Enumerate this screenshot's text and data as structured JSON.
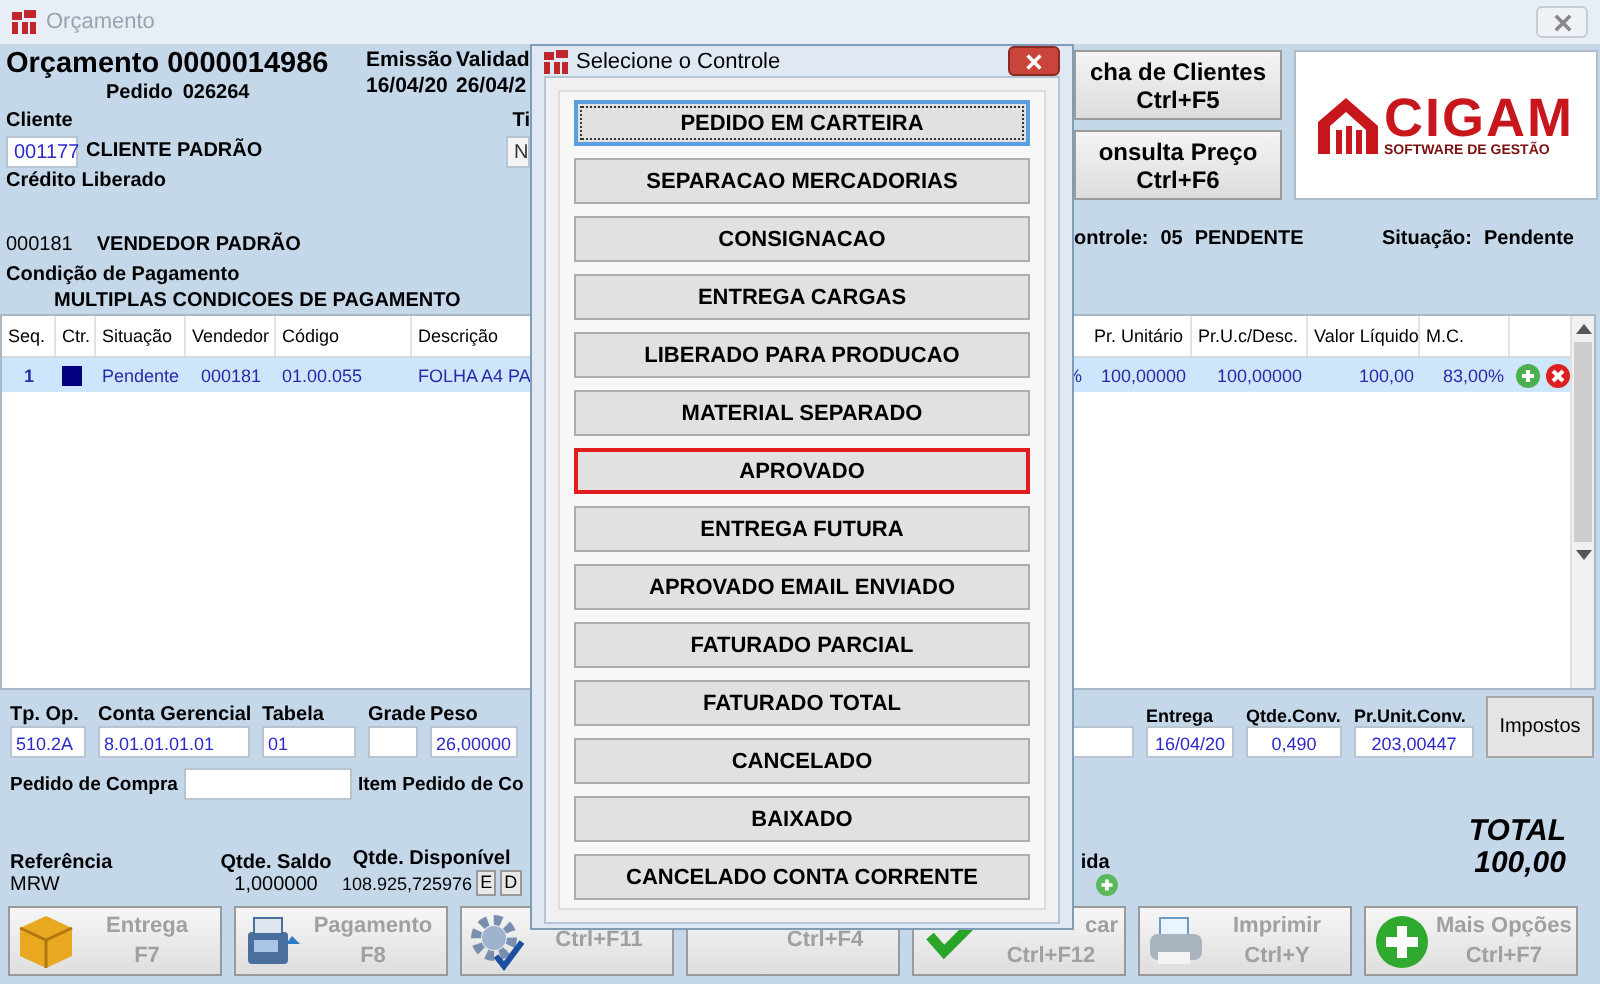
{
  "window": {
    "title": "Orçamento"
  },
  "header": {
    "title": "Orçamento 0000014986",
    "pedido_label": "Pedido",
    "pedido": "026264",
    "emissao_label": "Emissão",
    "emissao": "16/04/20",
    "validade_label": "Validad",
    "validade": "26/04/2",
    "cliente_label": "Cliente",
    "cliente_code": "001177",
    "cliente_name": "CLIENTE PADRÃO",
    "column_label": "Ti",
    "column_value": "N",
    "credito": "Crédito Liberado",
    "vendedor_code": "000181",
    "vendedor_name": "VENDEDOR PADRÃO",
    "condicao_label": "Condição de Pagamento",
    "condicao": "MULTIPLAS CONDICOES DE PAGAMENTO",
    "controle_label": "ontrole:",
    "controle_code": "05",
    "controle_status": "PENDENTE",
    "situacao_label": "Situação:",
    "situacao": "Pendente"
  },
  "side_buttons": [
    {
      "label": "cha de Clientes",
      "shortcut": "Ctrl+F5"
    },
    {
      "label": "onsulta Preço",
      "shortcut": "Ctrl+F6"
    }
  ],
  "logo": {
    "name": "CIGAM",
    "tagline": "SOFTWARE DE GESTÃO"
  },
  "table": {
    "columns": [
      "Seq.",
      "Ctr.",
      "Situação",
      "Vendedor",
      "Código",
      "Descrição",
      "Pr. Unitário",
      "Pr.U.c/Desc.",
      "Valor Líquido",
      "M.C."
    ],
    "rows": [
      {
        "selected": true,
        "seq": "1",
        "color": "#000080",
        "situacao": "Pendente",
        "vendedor": "000181",
        "codigo": "01.00.055",
        "descricao": "FOLHA A4 PA",
        "column_7": "%",
        "pr_unitario": "100,00000",
        "pr_uc_desc": "100,00000",
        "valor_liquido": "100,00",
        "mc": "83,00%"
      }
    ]
  },
  "fields": [
    {
      "label": "Tp. Op.",
      "value": "510.2A"
    },
    {
      "label": "Conta Gerencial",
      "value": "8.01.01.01.01"
    },
    {
      "label": "Tabela",
      "value": "01"
    },
    {
      "label": "Grade"
    },
    {
      "label": "Peso",
      "value": "26,00000"
    }
  ],
  "fields_right": [
    {
      "label": "Entrega",
      "value": "16/04/20"
    },
    {
      "label": "Qtde.Conv.",
      "value": "0,490"
    },
    {
      "label": "Pr.Unit.Conv.",
      "value": "203,00447"
    }
  ],
  "impostos_button": "Impostos",
  "pedido_compra_label": "Pedido de Compra",
  "item_pedido_label": "Item Pedido de Co",
  "referencia_label": "Referência",
  "referencia": "MRW",
  "saldo_label": "Qtde. Saldo",
  "saldo": "1,000000",
  "disponivel_label": "Qtde. Disponível",
  "disponivel": "108.925,725976",
  "disponivel_flags": [
    "E",
    "D"
  ],
  "column_ida_label": "ida",
  "total_label": "TOTAL",
  "total": "100,00",
  "bottom_buttons": [
    {
      "kind": "box",
      "label": "Entrega",
      "shortcut": "F7"
    },
    {
      "kind": "register",
      "label": "Pagamento",
      "shortcut": "F8"
    },
    {
      "kind": "gear",
      "shortcut": "Ctrl+F11"
    },
    {
      "kind": "plain",
      "shortcut": "Ctrl+F4"
    },
    {
      "kind": "check",
      "label": "car",
      "shortcut": "Ctrl+F12"
    },
    {
      "kind": "printer",
      "label": "Imprimir",
      "shortcut": "Ctrl+Y"
    },
    {
      "kind": "plus",
      "label": "Mais Opções",
      "shortcut": "Ctrl+F7"
    }
  ],
  "dialog": {
    "title": "Selecione o Controle",
    "options": [
      {
        "label": "PEDIDO EM CARTEIRA",
        "selected": false,
        "focused": true
      },
      {
        "label": "SEPARACAO MERCADORIAS",
        "selected": false,
        "focused": false
      },
      {
        "label": "CONSIGNACAO",
        "selected": false,
        "focused": false
      },
      {
        "label": "ENTREGA CARGAS",
        "selected": false,
        "focused": false
      },
      {
        "label": "LIBERADO PARA PRODUCAO",
        "selected": false,
        "focused": false
      },
      {
        "label": "MATERIAL SEPARADO",
        "selected": false,
        "focused": false
      },
      {
        "label": "APROVADO",
        "selected": true,
        "focused": false
      },
      {
        "label": "ENTREGA FUTURA",
        "selected": false,
        "focused": false
      },
      {
        "label": "APROVADO EMAIL ENVIADO",
        "selected": false,
        "focused": false
      },
      {
        "label": "FATURADO PARCIAL",
        "selected": false,
        "focused": false
      },
      {
        "label": "FATURADO TOTAL",
        "selected": false,
        "focused": false
      },
      {
        "label": "CANCELADO",
        "selected": false,
        "focused": false
      },
      {
        "label": "BAIXADO",
        "selected": false,
        "focused": false
      },
      {
        "label": "CANCELADO CONTA CORRENTE",
        "selected": false,
        "focused": false
      }
    ]
  }
}
